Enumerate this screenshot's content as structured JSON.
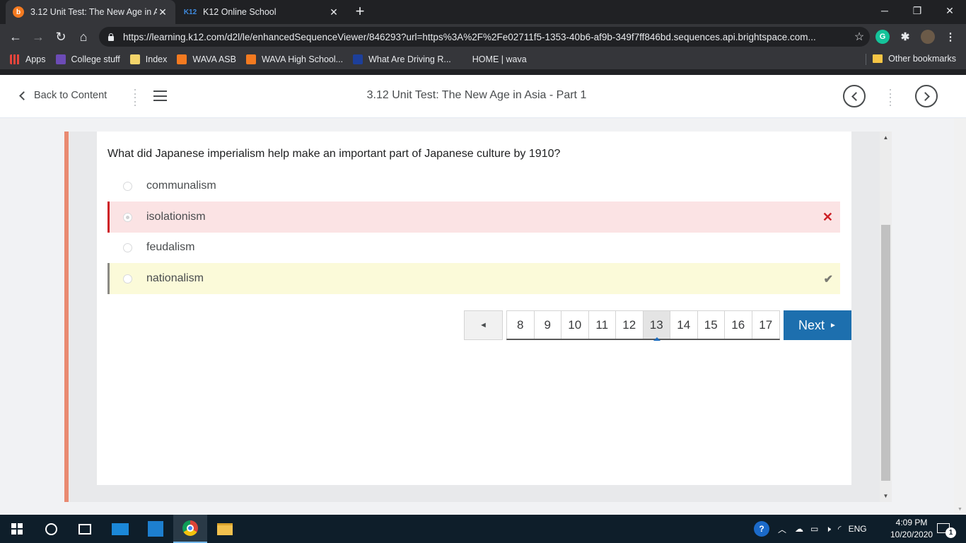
{
  "browser": {
    "tabs": [
      {
        "title": "3.12 Unit Test: The New Age in As",
        "favicon": "brightspace-icon"
      },
      {
        "title": "K12 Online School",
        "favicon": "K12"
      }
    ],
    "url": "https://learning.k12.com/d2l/le/enhancedSequenceViewer/846293?url=https%3A%2F%2Fe02711f5-1353-40b6-af9b-349f7ff846bd.sequences.api.brightspace.com...",
    "bookmarks": [
      {
        "label": "Apps",
        "color": "#e8453c"
      },
      {
        "label": "College stuff",
        "color": "#6c4bb6"
      },
      {
        "label": "Index",
        "color": "#f3d46a"
      },
      {
        "label": "WAVA ASB",
        "color": "#f47a20"
      },
      {
        "label": "WAVA High School...",
        "color": "#f47a20"
      },
      {
        "label": "What Are Driving R...",
        "color": "#1d3f9a"
      },
      {
        "label": "HOME | wava",
        "color": ""
      }
    ],
    "other_bookmarks": "Other bookmarks"
  },
  "header": {
    "back_label": "Back to Content",
    "title": "3.12 Unit Test: The New Age in Asia - Part 1"
  },
  "quiz": {
    "question": "What did Japanese imperialism help make an important part of Japanese culture by 1910?",
    "options": [
      {
        "label": "communalism",
        "state": "none"
      },
      {
        "label": "isolationism",
        "state": "selected-incorrect"
      },
      {
        "label": "feudalism",
        "state": "none"
      },
      {
        "label": "nationalism",
        "state": "correct"
      }
    ],
    "incorrect_mark": "✕",
    "correct_mark": "✔"
  },
  "pager": {
    "prev_symbol": "◄",
    "pages": [
      "8",
      "9",
      "10",
      "11",
      "12",
      "13",
      "14",
      "15",
      "16",
      "17"
    ],
    "current_page": "13",
    "next_label": "Next",
    "next_symbol": "►"
  },
  "taskbar": {
    "language": "ENG",
    "time": "4:09 PM",
    "date": "10/20/2020",
    "notification_count": "1"
  },
  "colors": {
    "accent_bar": "#e98a71",
    "next_button": "#1d6fae",
    "incorrect_bg": "#fbe3e4",
    "correct_bg": "#fbfad9"
  }
}
